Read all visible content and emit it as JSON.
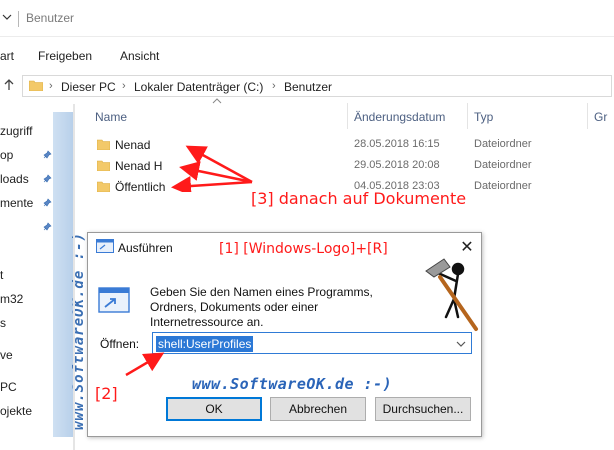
{
  "window": {
    "title": "Benutzer"
  },
  "ribbon": {
    "tabs": [
      "art",
      "Freigeben",
      "Ansicht"
    ]
  },
  "address": {
    "crumbs": [
      "Dieser PC",
      "Lokaler Datenträger (C:)",
      "Benutzer"
    ]
  },
  "nav": {
    "items": [
      "zugriff",
      "op",
      "loads",
      "mente",
      "t",
      "m32",
      "s",
      "ve",
      "PC",
      "ojekte"
    ],
    "watermark": "www.SoftwareOK.de :-)"
  },
  "columns": {
    "name": "Name",
    "date": "Änderungsdatum",
    "type": "Typ",
    "size": "Gr"
  },
  "files": [
    {
      "name": "Nenad",
      "date": "28.05.2018 16:15",
      "type": "Dateiordner"
    },
    {
      "name": "Nenad H",
      "date": "29.05.2018 20:08",
      "type": "Dateiordner"
    },
    {
      "name": "Öffentlich",
      "date": "04.05.2018 23:03",
      "type": "Dateiordner"
    }
  ],
  "annotations": {
    "step1": "[1] [Windows-Logo]+[R]",
    "step2": "[2]",
    "step3": "[3] danach auf Dokumente"
  },
  "dialog": {
    "title": "Ausführen",
    "close": "✕",
    "description": "Geben Sie den Namen eines Programms, Ordners, Dokuments oder einer Internetressource an.",
    "open_label": "Öffnen:",
    "open_value": "shell:UserProfiles",
    "watermark": "www.SoftwareOK.de :-)",
    "buttons": {
      "ok": "OK",
      "cancel": "Abbrechen",
      "browse": "Durchsuchen..."
    }
  },
  "colors": {
    "accent": "#0078d7",
    "annotation": "#ff1a1a",
    "watermark": "#2a64b8"
  }
}
